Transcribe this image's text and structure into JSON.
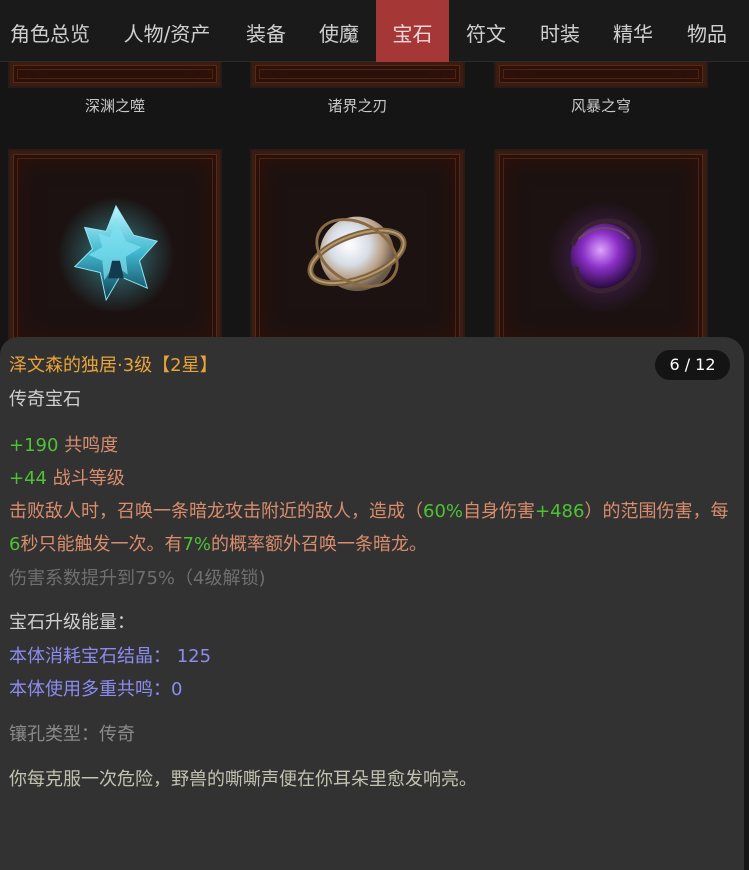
{
  "nav": {
    "tabs": [
      {
        "label": "角色总览"
      },
      {
        "label": "人物/资产"
      },
      {
        "label": "装备"
      },
      {
        "label": "使魔"
      },
      {
        "label": "宝石",
        "active": true
      },
      {
        "label": "符文"
      },
      {
        "label": "时装"
      },
      {
        "label": "精华"
      },
      {
        "label": "物品"
      }
    ]
  },
  "gems": {
    "top_row": [
      {
        "name": "深渊之噬"
      },
      {
        "name": "诸界之刃"
      },
      {
        "name": "风暴之穹"
      }
    ],
    "second_row": [
      {
        "icon": "blue-crystal-gem-icon"
      },
      {
        "icon": "pearl-orb-gem-icon"
      },
      {
        "icon": "purple-dragon-orb-gem-icon"
      }
    ]
  },
  "detail": {
    "title": "泽文森的独居·3级【2星】",
    "counter": "6 / 12",
    "type": "传奇宝石",
    "stats": [
      {
        "value": "+190",
        "label": "共鸣度"
      },
      {
        "value": "+44",
        "label": "战斗等级"
      }
    ],
    "effect": {
      "p1": "击败敌人时，召唤一条暗龙攻击附近的敌人，造成（",
      "v1": "60%",
      "p2": "自身伤害",
      "v2": "+486",
      "p3": "）的范围伤害，每",
      "v3": "6",
      "p4": "秒只能触发一次。有",
      "v4": "7%",
      "p5": "的概率额外召唤一条暗龙。"
    },
    "locked_line": "伤害系数提升到75%（4级解锁)",
    "upgrade_heading": "宝石升级能量：",
    "upgrade_lines": [
      {
        "label": "本体消耗宝石结晶：",
        "value": "125"
      },
      {
        "label": "本体使用多重共鸣：",
        "value": "0"
      }
    ],
    "socket_type": "镶孔类型：传奇",
    "flavor_text": "你每克服一次危险，野兽的嘶嘶声便在你耳朵里愈发响亮。"
  },
  "colors": {
    "accent_tab": "#a63737",
    "title_orange": "#e8a43a",
    "stat_green": "#4ec234",
    "effect_salmon": "#d98d6d",
    "upgrade_blue": "#8c8cf0"
  }
}
